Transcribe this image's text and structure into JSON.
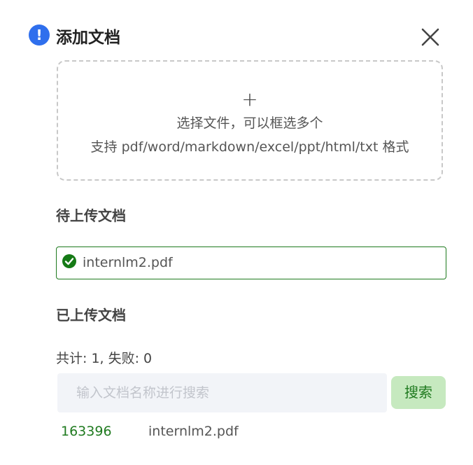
{
  "dialog": {
    "title": "添加文档",
    "info_icon_glyph": "!",
    "info_icon": "info-icon",
    "close_icon": "close-icon",
    "accent_color": "#2f6fed"
  },
  "upload": {
    "plus_glyph": "+",
    "hint": "选择文件，可以框选多个",
    "formats": "支持 pdf/word/markdown/excel/ppt/html/txt 格式"
  },
  "pending": {
    "title": "待上传文档",
    "items": [
      {
        "name": "internlm2.pdf",
        "status_icon": "check-circle-icon",
        "status_color": "#157a16"
      }
    ]
  },
  "uploaded": {
    "title": "已上传文档",
    "summary": "共计: 1, 失败: 0",
    "search": {
      "placeholder": "输入文档名称进行搜索",
      "value": "",
      "button_label": "搜索",
      "button_bg": "#c6e9bf",
      "button_color": "#1f7a1f"
    },
    "docs": [
      {
        "id": "163396",
        "name": "internlm2.pdf"
      }
    ]
  }
}
